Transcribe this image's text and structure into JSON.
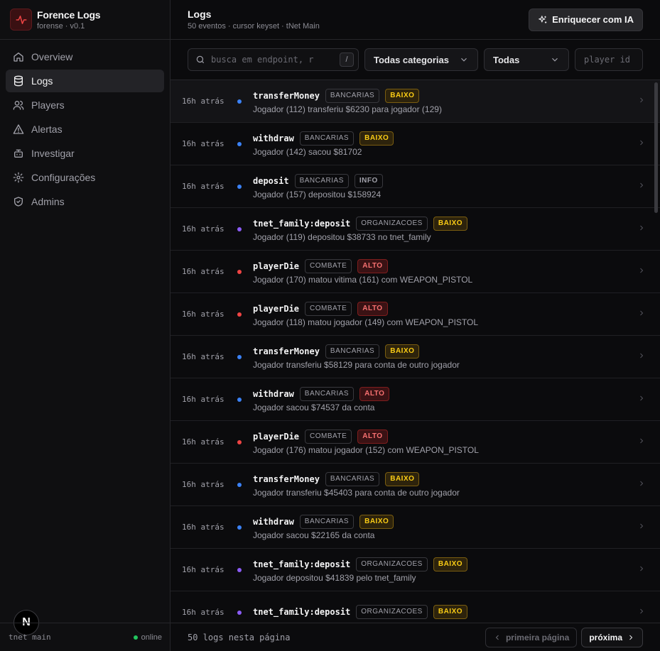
{
  "brand": {
    "name": "Forence Logs",
    "sub": "forense · v0.1"
  },
  "nav": [
    {
      "label": "Overview",
      "icon": "home-icon",
      "active": false
    },
    {
      "label": "Logs",
      "icon": "database-icon",
      "active": true
    },
    {
      "label": "Players",
      "icon": "users-icon",
      "active": false
    },
    {
      "label": "Alertas",
      "icon": "alert-triangle-icon",
      "active": false
    },
    {
      "label": "Investigar",
      "icon": "bot-icon",
      "active": false
    },
    {
      "label": "Configurações",
      "icon": "gear-icon",
      "active": false
    },
    {
      "label": "Admins",
      "icon": "shield-check-icon",
      "active": false
    }
  ],
  "sidebar_footer": {
    "server": "tnet main",
    "status": "online"
  },
  "header": {
    "title": "Logs",
    "subtitle": "50 eventos · cursor keyset · tNet Main",
    "ai_button": "Enriquecer com IA"
  },
  "filters": {
    "search_placeholder": "busca em endpoint, r",
    "search_shortcut": "/",
    "category": "Todas categorias",
    "severity": "Todas",
    "player_placeholder": "player id"
  },
  "colors": {
    "bancarias": "#3b82f6",
    "organizacoes": "#8b5cf6",
    "combate": "#ef4444",
    "accent": "#ef4444"
  },
  "logs": [
    {
      "time": "16h atrás",
      "event": "transferMoney",
      "category": "BANCARIAS",
      "severity": "BAIXO",
      "desc": "Jogador (112) transferiu $6230 para jogador (129)"
    },
    {
      "time": "16h atrás",
      "event": "withdraw",
      "category": "BANCARIAS",
      "severity": "BAIXO",
      "desc": "Jogador (142) sacou $81702"
    },
    {
      "time": "16h atrás",
      "event": "deposit",
      "category": "BANCARIAS",
      "severity": "INFO",
      "desc": "Jogador (157) depositou $158924"
    },
    {
      "time": "16h atrás",
      "event": "tnet_family:deposit",
      "category": "ORGANIZACOES",
      "severity": "BAIXO",
      "desc": "Jogador (119) depositou $38733 no tnet_family"
    },
    {
      "time": "16h atrás",
      "event": "playerDie",
      "category": "COMBATE",
      "severity": "ALTO",
      "desc": "Jogador (170) matou vitima (161) com WEAPON_PISTOL"
    },
    {
      "time": "16h atrás",
      "event": "playerDie",
      "category": "COMBATE",
      "severity": "ALTO",
      "desc": "Jogador (118) matou jogador (149) com WEAPON_PISTOL"
    },
    {
      "time": "16h atrás",
      "event": "transferMoney",
      "category": "BANCARIAS",
      "severity": "BAIXO",
      "desc": "Jogador transferiu $58129 para conta de outro jogador"
    },
    {
      "time": "16h atrás",
      "event": "withdraw",
      "category": "BANCARIAS",
      "severity": "ALTO",
      "desc": "Jogador sacou $74537 da conta"
    },
    {
      "time": "16h atrás",
      "event": "playerDie",
      "category": "COMBATE",
      "severity": "ALTO",
      "desc": "Jogador (176) matou jogador (152) com WEAPON_PISTOL"
    },
    {
      "time": "16h atrás",
      "event": "transferMoney",
      "category": "BANCARIAS",
      "severity": "BAIXO",
      "desc": "Jogador transferiu $45403 para conta de outro jogador"
    },
    {
      "time": "16h atrás",
      "event": "withdraw",
      "category": "BANCARIAS",
      "severity": "BAIXO",
      "desc": "Jogador sacou $22165 da conta"
    },
    {
      "time": "16h atrás",
      "event": "tnet_family:deposit",
      "category": "ORGANIZACOES",
      "severity": "BAIXO",
      "desc": "Jogador depositou $41839 pelo tnet_family"
    },
    {
      "time": "16h atrás",
      "event": "tnet_family:deposit",
      "category": "ORGANIZACOES",
      "severity": "BAIXO",
      "desc": ""
    }
  ],
  "footer": {
    "count": "50 logs nesta página",
    "first": "primeira página",
    "next": "próxima"
  }
}
